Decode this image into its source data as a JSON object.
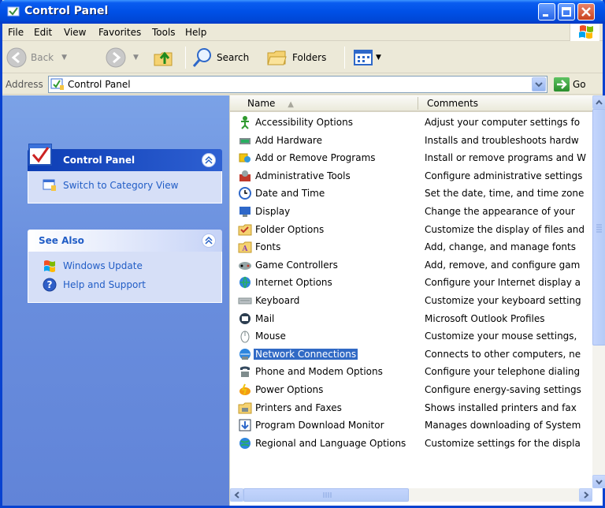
{
  "window": {
    "title": "Control Panel"
  },
  "menu": [
    "File",
    "Edit",
    "View",
    "Favorites",
    "Tools",
    "Help"
  ],
  "toolbar": {
    "back": "Back",
    "search": "Search",
    "folders": "Folders"
  },
  "address": {
    "label": "Address",
    "value": "Control Panel",
    "go": "Go"
  },
  "taskpane": {
    "main_title": "Control Panel",
    "switch_label": "Switch to Category View",
    "see_also_title": "See Also",
    "see_also": [
      "Windows Update",
      "Help and Support"
    ]
  },
  "list": {
    "columns": {
      "name": "Name",
      "comments": "Comments"
    },
    "items": [
      {
        "name": "Accessibility Options",
        "comment": "Adjust your computer settings fo",
        "icon": "accessibility-icon"
      },
      {
        "name": "Add Hardware",
        "comment": "Installs and troubleshoots hardw",
        "icon": "hardware-icon"
      },
      {
        "name": "Add or Remove Programs",
        "comment": "Install or remove programs and W",
        "icon": "programs-icon"
      },
      {
        "name": "Administrative Tools",
        "comment": "Configure administrative settings",
        "icon": "admin-tools-icon"
      },
      {
        "name": "Date and Time",
        "comment": "Set the date, time, and time zone",
        "icon": "clock-icon"
      },
      {
        "name": "Display",
        "comment": "Change the appearance of your",
        "icon": "display-icon"
      },
      {
        "name": "Folder Options",
        "comment": "Customize the display of files and",
        "icon": "folder-options-icon"
      },
      {
        "name": "Fonts",
        "comment": "Add, change, and manage fonts",
        "icon": "fonts-folder-icon"
      },
      {
        "name": "Game Controllers",
        "comment": "Add, remove, and configure gam",
        "icon": "gamepad-icon"
      },
      {
        "name": "Internet Options",
        "comment": "Configure your Internet display a",
        "icon": "globe-icon"
      },
      {
        "name": "Keyboard",
        "comment": "Customize your keyboard setting",
        "icon": "keyboard-icon"
      },
      {
        "name": "Mail",
        "comment": "Microsoft Outlook Profiles",
        "icon": "mail-icon"
      },
      {
        "name": "Mouse",
        "comment": "Customize your mouse settings,",
        "icon": "mouse-icon"
      },
      {
        "name": "Network Connections",
        "comment": "Connects to other computers, ne",
        "icon": "network-icon",
        "selected": true
      },
      {
        "name": "Phone and Modem Options",
        "comment": "Configure your telephone dialing",
        "icon": "phone-icon"
      },
      {
        "name": "Power Options",
        "comment": "Configure energy-saving settings",
        "icon": "power-icon"
      },
      {
        "name": "Printers and Faxes",
        "comment": "Shows installed printers and fax",
        "icon": "printer-icon"
      },
      {
        "name": "Program Download Monitor",
        "comment": "Manages downloading of System",
        "icon": "download-monitor-icon"
      },
      {
        "name": "Regional and Language Options",
        "comment": "Customize settings for the displa",
        "icon": "regional-icon"
      }
    ]
  },
  "colors": {
    "titlebar": "#0050e6",
    "taskpane": "#6a8fde",
    "selection": "#316ac5",
    "link": "#215dc6"
  }
}
